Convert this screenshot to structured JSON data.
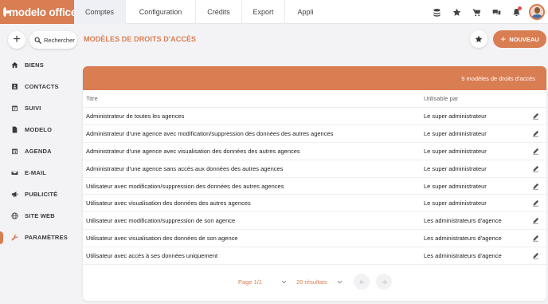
{
  "app": {
    "logo_text": "modelo office"
  },
  "nav": {
    "tabs": [
      {
        "label": "Comptes",
        "active": true
      },
      {
        "label": "Configuration",
        "active": false
      },
      {
        "label": "Crédits",
        "active": false
      },
      {
        "label": "Export",
        "active": false
      },
      {
        "label": "Appli",
        "active": false
      }
    ]
  },
  "top_icons": [
    "stack-icon",
    "star-icon",
    "cart-icon",
    "chat-icon",
    "bell-icon"
  ],
  "header": {
    "add_label": "+",
    "search_label": "Rechercher",
    "page_title": "MODÈLES DE DROITS D'ACCÈS",
    "new_label": "NOUVEAU"
  },
  "sidebar": {
    "items": [
      {
        "label": "BIENS",
        "icon": "home-icon"
      },
      {
        "label": "CONTACTS",
        "icon": "contact-card-icon"
      },
      {
        "label": "SUIVI",
        "icon": "calendar-check-icon"
      },
      {
        "label": "MODELO",
        "icon": "document-icon"
      },
      {
        "label": "AGENDA",
        "icon": "calendar-icon"
      },
      {
        "label": "E-MAIL",
        "icon": "envelope-icon"
      },
      {
        "label": "PUBLICITÉ",
        "icon": "megaphone-icon"
      },
      {
        "label": "SITE WEB",
        "icon": "globe-icon"
      },
      {
        "label": "PARAMÈTRES",
        "icon": "wrench-icon",
        "active": true
      }
    ]
  },
  "panel": {
    "count_label": "9 modèles de droits d'accès",
    "columns": {
      "title": "Titre",
      "user": "Utilisable par"
    },
    "rows": [
      {
        "title": "Administrateur de toutes les agences",
        "user": "Le super administrateur"
      },
      {
        "title": "Administrateur d'une agence avec modification/suppression des données des autres agences",
        "user": "Le super administrateur"
      },
      {
        "title": "Administrateur d'une agence avec visualisation des données des autres agences",
        "user": "Le super administrateur"
      },
      {
        "title": "Administrateur d'une agence sans accès aux données des autres agences",
        "user": "Le super administrateur"
      },
      {
        "title": "Utilisateur avec modification/suppression des données des autres agences",
        "user": "Le super administrateur"
      },
      {
        "title": "Utilisateur avec visualisation des données des autres agences",
        "user": "Le super administrateur"
      },
      {
        "title": "Utilisateur avec modification/suppression de son agence",
        "user": "Les administrateurs d'agence"
      },
      {
        "title": "Utilisateur avec visualisation des données de son agence",
        "user": "Les administrateurs d'agence"
      },
      {
        "title": "Utilisateur avec accès à ses données uniquement",
        "user": "Les administrateurs d'agence"
      }
    ],
    "pager": {
      "page": "Page 1/1",
      "per_page": "20 résultats"
    }
  },
  "colors": {
    "accent": "#d97d52",
    "background": "#f3f3f5"
  }
}
